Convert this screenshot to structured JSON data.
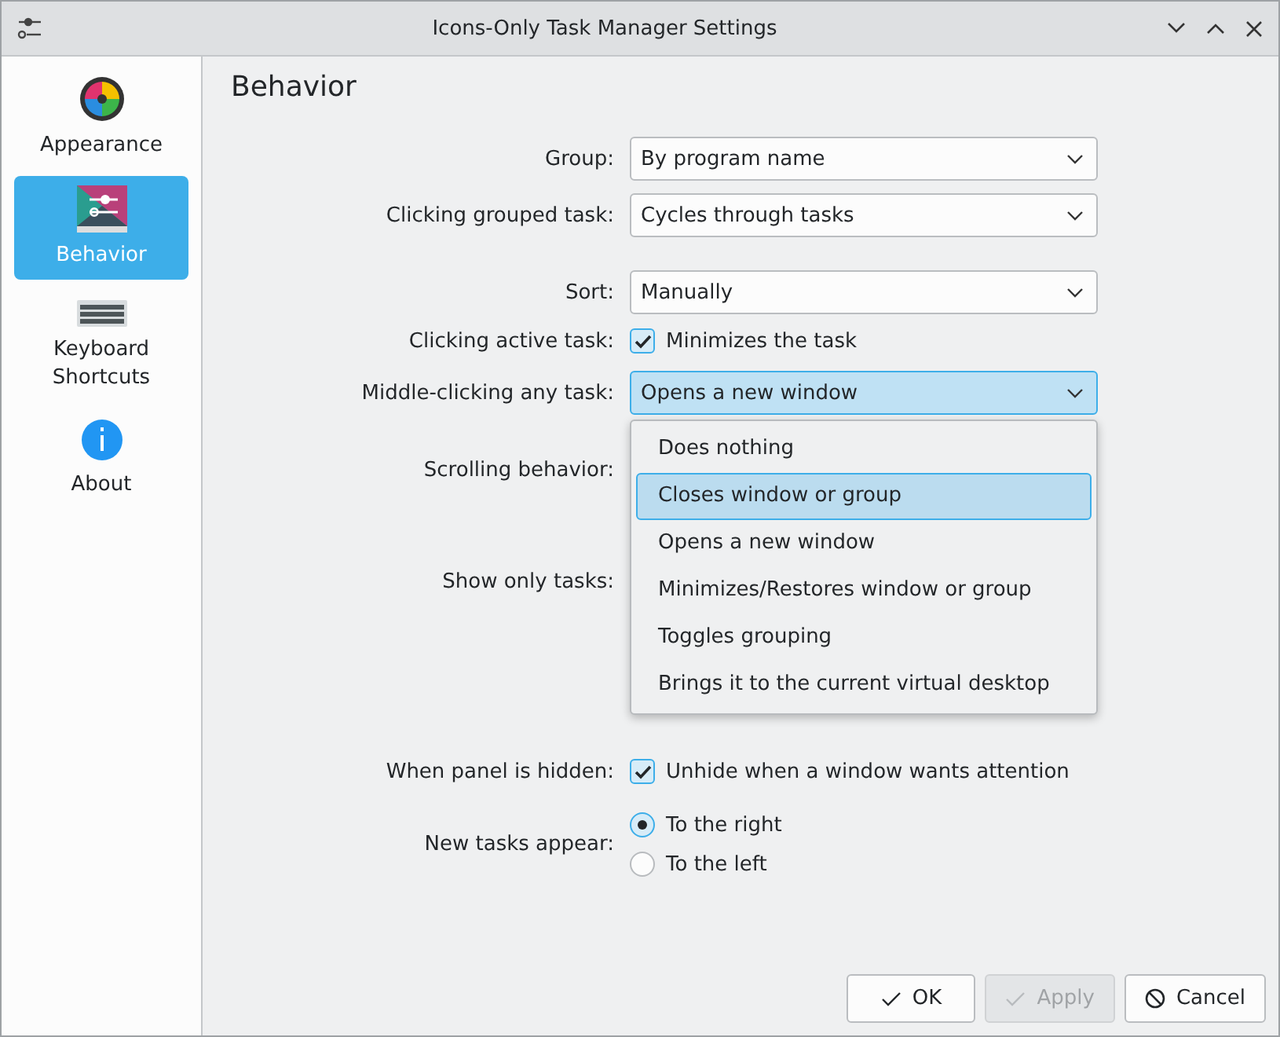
{
  "window": {
    "title": "Icons-Only Task Manager Settings"
  },
  "sidebar": {
    "items": [
      {
        "label": "Appearance",
        "kind": "appearance",
        "selected": false
      },
      {
        "label": "Behavior",
        "kind": "behavior",
        "selected": true
      },
      {
        "label": "Keyboard Shortcuts",
        "kind": "keyboard",
        "selected": false
      },
      {
        "label": "About",
        "kind": "about",
        "selected": false
      }
    ]
  },
  "heading": "Behavior",
  "form": {
    "rows": [
      {
        "label": "Group:",
        "kind": "combo",
        "value": "By program name",
        "open": false
      },
      {
        "label": "Clicking grouped task:",
        "kind": "combo",
        "value": "Cycles through tasks",
        "open": false
      },
      {
        "label": "Sort:",
        "kind": "combo",
        "value": "Manually",
        "open": false
      },
      {
        "label": "Clicking active task:",
        "kind": "check",
        "options": [
          {
            "label": "Minimizes the task",
            "checked": true
          }
        ]
      },
      {
        "label": "Middle-clicking any task:",
        "kind": "combo",
        "value": "Opens a new window",
        "open": true,
        "menu": [
          {
            "label": "Does nothing",
            "highlighted": false
          },
          {
            "label": "Closes window or group",
            "highlighted": true
          },
          {
            "label": "Opens a new window",
            "highlighted": false
          },
          {
            "label": "Minimizes/Restores window or group",
            "highlighted": false
          },
          {
            "label": "Toggles grouping",
            "highlighted": false
          },
          {
            "label": "Brings it to the current virtual desktop",
            "highlighted": false
          }
        ]
      },
      {
        "label": "Scrolling behavior:",
        "kind": "covered"
      },
      {
        "label": "Show only tasks:",
        "kind": "covered"
      },
      {
        "label": "When panel is hidden:",
        "kind": "check",
        "options": [
          {
            "label": "Unhide when a window wants attention",
            "checked": true
          }
        ]
      },
      {
        "label": "New tasks appear:",
        "kind": "radio",
        "options": [
          {
            "label": "To the right",
            "selected": true
          },
          {
            "label": "To the left",
            "selected": false
          }
        ]
      }
    ]
  },
  "buttons": [
    {
      "label": "OK",
      "kind": "ok",
      "disabled": false
    },
    {
      "label": "Apply",
      "kind": "ok",
      "disabled": true
    },
    {
      "label": "Cancel",
      "kind": "cancel",
      "disabled": false
    }
  ]
}
